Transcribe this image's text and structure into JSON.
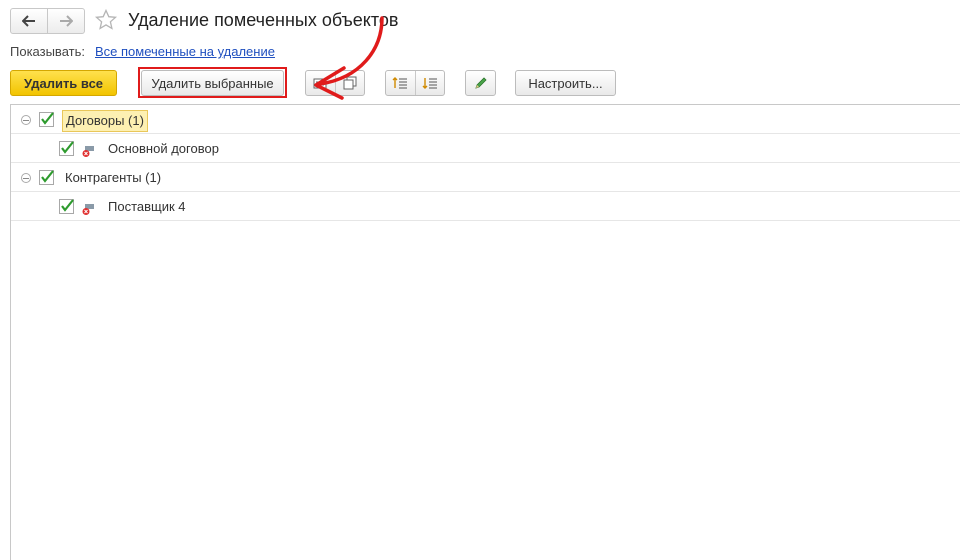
{
  "header": {
    "title": "Удаление помеченных объектов",
    "nav": {
      "back": "arrow-left-icon",
      "forward": "arrow-right-icon"
    },
    "favorite_icon": "star-icon"
  },
  "filter": {
    "label": "Показывать:",
    "link": "Все помеченные на удаление"
  },
  "toolbar": {
    "delete_all": "Удалить все",
    "delete_selected": "Удалить выбранные",
    "configure": "Настроить..."
  },
  "tree": [
    {
      "label": "Договоры (1)",
      "checked": true,
      "children": [
        {
          "label": "Основной договор",
          "checked": true
        }
      ]
    },
    {
      "label": "Контрагенты (1)",
      "checked": true,
      "children": [
        {
          "label": "Поставщик 4",
          "checked": true
        }
      ]
    }
  ],
  "colors": {
    "primary_button": "#f2c400",
    "link": "#1f4fbf",
    "annotation": "#e01b1b",
    "check": "#2e9b2e"
  }
}
